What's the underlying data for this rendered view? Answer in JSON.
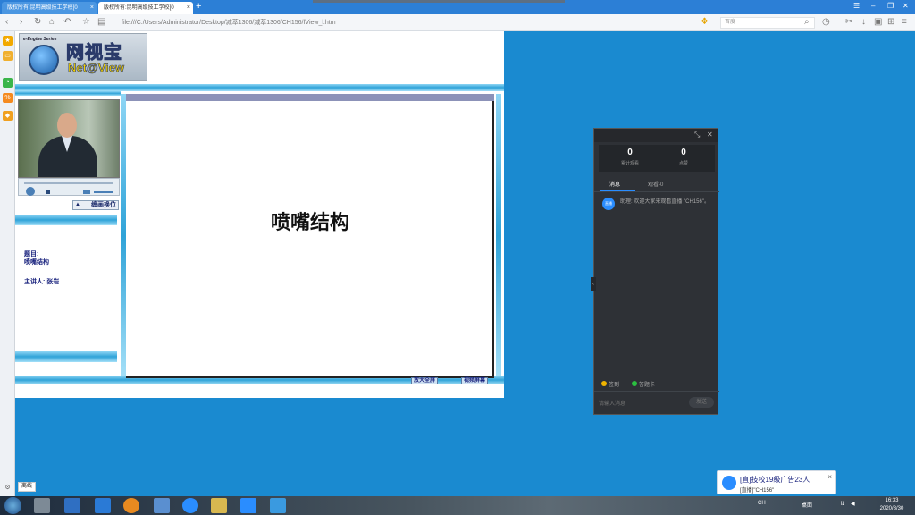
{
  "browser": {
    "tabs": [
      {
        "label": "版权所有:昆明高级技工学校[0"
      },
      {
        "label": "版权所有:昆明高级技工学校[0"
      }
    ],
    "url": "file:///C:/Users/Administrator/Desktop/减萃1306/减萃1306/CH156/fView_l.htm",
    "search_placeholder": "百度"
  },
  "sidebar": {
    "status_label": "离线"
  },
  "webpage": {
    "logo": {
      "series_text": "e-Engine Series",
      "name_cn": "网视宝",
      "name_en": "Net@View"
    },
    "switch_button": "缠画换位",
    "topic_label": "题目:",
    "topic_value": "喷嘴结构",
    "speaker_label": "主讲人:",
    "speaker_value": "张岩",
    "slide_title": "喷嘴结构",
    "btn_fullscreen": "放大全屏",
    "btn_close": "视频屏幕"
  },
  "chat_panel": {
    "stats": [
      {
        "value": "0",
        "label": "累计观看"
      },
      {
        "value": "0",
        "label": "点赞"
      }
    ],
    "tabs": [
      {
        "label": "消息"
      },
      {
        "label": "观看-0"
      }
    ],
    "message": {
      "avatar": "直播",
      "text": "助理: 欢迎大家来观看直播 \"CH156\"。"
    },
    "footer_like": "签到",
    "footer_card": "答题卡",
    "input_placeholder": "请输入消息",
    "send_button": "发送"
  },
  "notification": {
    "title": "[直]技校19级广告23人",
    "subtitle": "[直播]\"CH156\""
  },
  "taskbar": {
    "tray_lang": "CH",
    "tray_text": "桌面",
    "time": "16:33",
    "date": "2020/8/30"
  },
  "colors": {
    "desktop": "#1a8ad0",
    "tab_active": "#ffffff",
    "chat_bg": "#2e3136",
    "accent": "#2a8dff"
  }
}
